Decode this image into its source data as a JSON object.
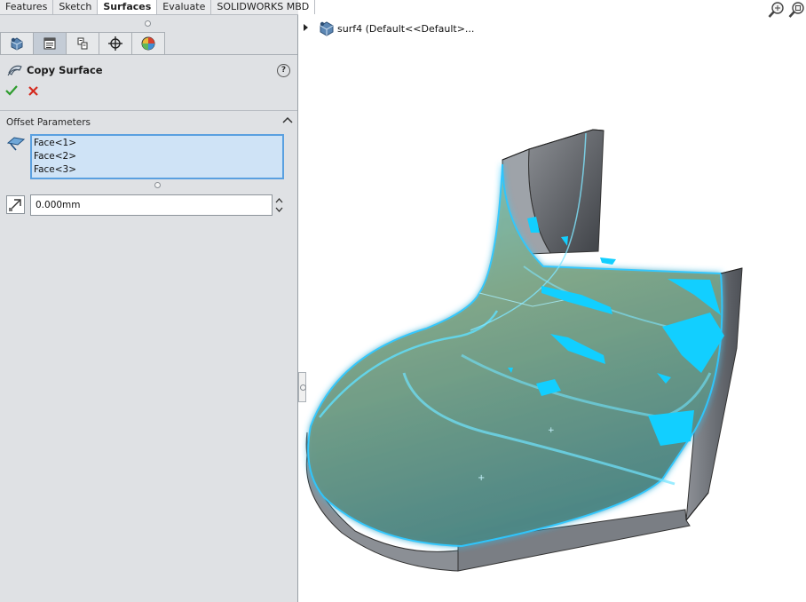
{
  "command_tabs": [
    "Features",
    "Sketch",
    "Surfaces",
    "Evaluate",
    "SOLIDWORKS MBD"
  ],
  "active_tab": "Surfaces",
  "property_manager": {
    "icon_tabs": [
      "feature-manager-icon",
      "property-manager-icon",
      "configuration-manager-icon",
      "dimxpert-icon",
      "display-manager-icon"
    ],
    "title": "Copy Surface",
    "help": "?",
    "section": "Offset Parameters",
    "faces": [
      "Face<1>",
      "Face<2>",
      "Face<3>"
    ],
    "offset_value": "0.000mm"
  },
  "feature_tree": {
    "root_label": "surf4  (Default<<Default>..."
  },
  "colors": {
    "selection_highlight": "#2ec8ff",
    "panel_bg": "#dfe1e4",
    "ok_green": "#2e9c2e",
    "cancel_red": "#d42a1e"
  }
}
